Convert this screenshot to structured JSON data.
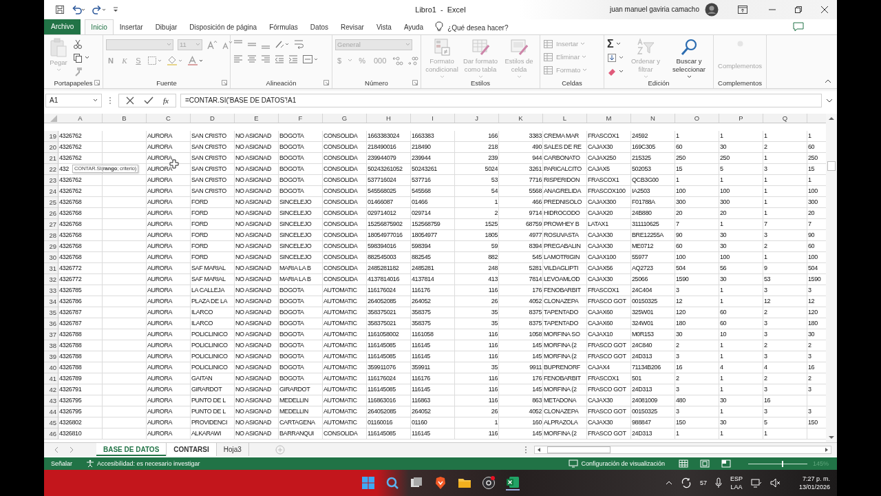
{
  "title_bar": {
    "title": "Libro1  -  Excel",
    "user": "juan manuel gaviria camacho"
  },
  "ribbon_tabs": [
    {
      "label": "Archivo",
      "kind": "file",
      "selected": false
    },
    {
      "label": "Inicio",
      "kind": "tab",
      "selected": true
    },
    {
      "label": "Insertar",
      "kind": "tab",
      "selected": false
    },
    {
      "label": "Dibujar",
      "kind": "tab",
      "selected": false
    },
    {
      "label": "Disposición de página",
      "kind": "tab",
      "selected": false
    },
    {
      "label": "Fórmulas",
      "kind": "tab",
      "selected": false
    },
    {
      "label": "Datos",
      "kind": "tab",
      "selected": false
    },
    {
      "label": "Revisar",
      "kind": "tab",
      "selected": false
    },
    {
      "label": "Vista",
      "kind": "tab",
      "selected": false
    },
    {
      "label": "Ayuda",
      "kind": "tab",
      "selected": false
    }
  ],
  "tell_me": {
    "placeholder": "¿Qué desea hacer?"
  },
  "ribbon": [
    {
      "kind": "clipboard",
      "label": "Portapapeles",
      "items": [
        {
          "label": "Pegar",
          "disabled": true
        }
      ]
    },
    {
      "kind": "font",
      "label": "Fuente",
      "disabled": true,
      "size": "11",
      "styles": [
        "N",
        "K",
        "S"
      ]
    },
    {
      "kind": "alignment",
      "label": "Alineación"
    },
    {
      "kind": "number",
      "label": "Número",
      "disabled": true,
      "format": "General",
      "symbols": [
        "$",
        "%",
        "000"
      ]
    },
    {
      "kind": "styles",
      "label": "Estilos",
      "items": [
        {
          "label": "Formato condicional",
          "disabled": true
        },
        {
          "label": "Dar formato como tabla",
          "disabled": true
        },
        {
          "label": "Estilos de celda",
          "disabled": true
        }
      ]
    },
    {
      "kind": "cells",
      "label": "Celdas",
      "items": [
        {
          "label": "Insertar",
          "disabled": true
        },
        {
          "label": "Eliminar",
          "disabled": true
        },
        {
          "label": "Formato",
          "disabled": true
        }
      ]
    },
    {
      "kind": "editing",
      "label": "Edición",
      "sum": "Σ",
      "items": [
        {
          "label": "Ordenar y filtrar",
          "disabled": true
        },
        {
          "label": "Buscar y seleccionar",
          "disabled": false
        }
      ]
    },
    {
      "kind": "addins",
      "label": "Complementos",
      "items": [
        {
          "label": "Complementos",
          "disabled": true
        }
      ]
    }
  ],
  "formula_bar": {
    "name_box": "A1",
    "fx": "fx",
    "formula": "=CONTAR.SI('BASE DE DATOS'!A1"
  },
  "columns": [
    {
      "label": "A",
      "kind": "text"
    },
    {
      "label": "B",
      "kind": "text"
    },
    {
      "label": "C",
      "kind": "text"
    },
    {
      "label": "D",
      "kind": "text"
    },
    {
      "label": "E",
      "kind": "text"
    },
    {
      "label": "F",
      "kind": "text"
    },
    {
      "label": "G",
      "kind": "text"
    },
    {
      "label": "H",
      "kind": "text"
    },
    {
      "label": "I",
      "kind": "text"
    },
    {
      "label": "J",
      "kind": "number"
    },
    {
      "label": "K",
      "kind": "number"
    },
    {
      "label": "L",
      "kind": "text"
    },
    {
      "label": "M",
      "kind": "text"
    },
    {
      "label": "N",
      "kind": "text"
    },
    {
      "label": "O",
      "kind": "text"
    },
    {
      "label": "P",
      "kind": "text"
    },
    {
      "label": "Q",
      "kind": "text"
    },
    {
      "kind": "text"
    }
  ],
  "rows": [
    {
      "number": "19",
      "cells": [
        "4326762",
        null,
        "AURORA",
        "SAN CRISTO",
        "NO ASIGNAD",
        "BOGOTA",
        "CONSOLIDA",
        "1663383024",
        "1663383",
        "166",
        "3383",
        "CREMA MAR",
        "FRASCOX1",
        "24592",
        "1",
        "1",
        "1",
        "1"
      ]
    },
    {
      "number": "20",
      "cells": [
        "4326762",
        null,
        "AURORA",
        "SAN CRISTO",
        "NO ASIGNAD",
        "BOGOTA",
        "CONSOLIDA",
        "218490016",
        "218490",
        "218",
        "490",
        "SALES DE RE",
        "CAJAX30",
        "169C305",
        "60",
        "30",
        "2",
        "60"
      ]
    },
    {
      "number": "21",
      "cells": [
        "4326762",
        null,
        "AURORA",
        "SAN CRISTO",
        "NO ASIGNAD",
        "BOGOTA",
        "CONSOLIDA",
        "239944079",
        "239944",
        "239",
        "944",
        "CARBONATO",
        "CAJAX250",
        "215325",
        "250",
        "250",
        "1",
        "250"
      ]
    },
    {
      "number": "22",
      "cells": [
        "432",
        null,
        "AURORA",
        "SAN CRISTO",
        "NO ASIGNAD",
        "BOGOTA",
        "CONSOLIDA",
        "50243261052",
        "50243261",
        "5024",
        "3261",
        "PARICALCITO",
        "CAJAX5",
        "502053",
        "15",
        "5",
        "3",
        "15"
      ]
    },
    {
      "number": "23",
      "cells": [
        "4326762",
        null,
        "AURORA",
        "SAN CRISTO",
        "NO ASIGNAD",
        "BOGOTA",
        "CONSOLIDA",
        "537716024",
        "537716",
        "53",
        "7716",
        "RISPERIDON",
        "FRASCOX1",
        "QCB3G00",
        "1",
        "1",
        "1",
        "1"
      ]
    },
    {
      "number": "24",
      "cells": [
        "4326762",
        null,
        "AURORA",
        "SAN CRISTO",
        "NO ASIGNAD",
        "BOGOTA",
        "CONSOLIDA",
        "545568025",
        "545568",
        "54",
        "5568",
        "ANAGRELIDA",
        "FRASCOX100",
        "IA2503",
        "100",
        "100",
        "1",
        "100"
      ]
    },
    {
      "number": "25",
      "cells": [
        "4326768",
        null,
        "AURORA",
        "FORD",
        "NO ASIGNAD",
        "SINCELEJO",
        "CONSOLIDA",
        "01466087",
        "01466",
        "1",
        "466",
        "PREDNISOLO",
        "CAJAX300",
        "F01788A",
        "300",
        "300",
        "1",
        "300"
      ]
    },
    {
      "number": "26",
      "cells": [
        "4326768",
        null,
        "AURORA",
        "FORD",
        "NO ASIGNAD",
        "SINCELEJO",
        "CONSOLIDA",
        "029714012",
        "029714",
        "2",
        "9714",
        "HIDROCODO",
        "CAJAX20",
        "24B880",
        "20",
        "20",
        "1",
        "20"
      ]
    },
    {
      "number": "27",
      "cells": [
        "4326768",
        null,
        "AURORA",
        "FORD",
        "NO ASIGNAD",
        "SINCELEJO",
        "CONSOLIDA",
        "15256875902",
        "152568759",
        "1525",
        "68759",
        "PROWHEY B",
        "LATAX1",
        "311110625",
        "7",
        "1",
        "7",
        "7"
      ]
    },
    {
      "number": "28",
      "cells": [
        "4326768",
        null,
        "AURORA",
        "FORD",
        "NO ASIGNAD",
        "SINCELEJO",
        "CONSOLIDA",
        "18054977016",
        "18054977",
        "1805",
        "4977",
        "ROSUVASTA",
        "CAJAX30",
        "BRE12255A",
        "90",
        "30",
        "3",
        "90"
      ]
    },
    {
      "number": "29",
      "cells": [
        "4326768",
        null,
        "AURORA",
        "FORD",
        "NO ASIGNAD",
        "SINCELEJO",
        "CONSOLIDA",
        "598394016",
        "598394",
        "59",
        "8394",
        "PREGABALIN",
        "CAJAX30",
        "ME0712",
        "60",
        "30",
        "2",
        "60"
      ]
    },
    {
      "number": "30",
      "cells": [
        "4326768",
        null,
        "AURORA",
        "FORD",
        "NO ASIGNAD",
        "SINCELEJO",
        "CONSOLIDA",
        "882545003",
        "882545",
        "882",
        "545",
        "LAMOTRIGIN",
        "CAJAX100",
        "55977",
        "100",
        "100",
        "1",
        "100"
      ]
    },
    {
      "number": "31",
      "cells": [
        "4326772",
        null,
        "AURORA",
        "SAF MARIAL",
        "NO ASIGNAD",
        "MARIA LA B",
        "CONSOLIDA",
        "2485281182",
        "2485281",
        "248",
        "5281",
        "VILDAGLIPTI",
        "CAJAX56",
        "AQ2723",
        "504",
        "56",
        "9",
        "504"
      ]
    },
    {
      "number": "32",
      "cells": [
        "4326772",
        null,
        "AURORA",
        "SAF MARIAL",
        "NO ASIGNAD",
        "MARIA LA B",
        "CONSOLIDA",
        "4137814016",
        "4137814",
        "413",
        "7814",
        "LEVOAMLOD",
        "CAJAX30",
        "25066",
        "1590",
        "30",
        "53",
        "1590"
      ]
    },
    {
      "number": "33",
      "cells": [
        "4326785",
        null,
        "AURORA",
        "LA CALLEJA",
        "NO ASIGNAD",
        "BOGOTA",
        "AUTOMATIC",
        "116176024",
        "116176",
        "116",
        "176",
        "FENOBARBIT",
        "FRASCOX1",
        "24C404",
        "3",
        "1",
        "3",
        "3"
      ]
    },
    {
      "number": "34",
      "cells": [
        "4326786",
        null,
        "AURORA",
        "PLAZA DE LA",
        "NO ASIGNAD",
        "BOGOTA",
        "AUTOMATIC",
        "264052085",
        "264052",
        "26",
        "4052",
        "CLONAZEPA",
        "FRASCO GOT",
        "00150325",
        "12",
        "1",
        "12",
        "12"
      ]
    },
    {
      "number": "35",
      "cells": [
        "4326787",
        null,
        "AURORA",
        "ILARCO",
        "NO ASIGNAD",
        "BOGOTA",
        "AUTOMATIC",
        "358375021",
        "358375",
        "35",
        "8375",
        "TAPENTADO",
        "CAJAX60",
        "325W01",
        "120",
        "60",
        "2",
        "120"
      ]
    },
    {
      "number": "36",
      "cells": [
        "4326787",
        null,
        "AURORA",
        "ILARCO",
        "NO ASIGNAD",
        "BOGOTA",
        "AUTOMATIC",
        "358375021",
        "358375",
        "35",
        "8375",
        "TAPENTADO",
        "CAJAX60",
        "324W01",
        "180",
        "60",
        "3",
        "180"
      ]
    },
    {
      "number": "37",
      "cells": [
        "4326788",
        null,
        "AURORA",
        "POLICLINICO",
        "NO ASIGNAD",
        "BOGOTA",
        "AUTOMATIC",
        "1161058002",
        "1161058",
        "116",
        "1058",
        "MORFINA SO",
        "CAJAX10",
        "M0R153",
        "30",
        "10",
        "3",
        "30"
      ]
    },
    {
      "number": "38",
      "cells": [
        "4326788",
        null,
        "AURORA",
        "POLICLINICO",
        "NO ASIGNAD",
        "BOGOTA",
        "AUTOMATIC",
        "116145085",
        "116145",
        "116",
        "145",
        "MORFINA (2",
        "FRASCO GOT",
        "24C840",
        "2",
        "1",
        "2",
        "2"
      ]
    },
    {
      "number": "39",
      "cells": [
        "4326788",
        null,
        "AURORA",
        "POLICLINICO",
        "NO ASIGNAD",
        "BOGOTA",
        "AUTOMATIC",
        "116145085",
        "116145",
        "116",
        "145",
        "MORFINA (2",
        "FRASCO GOT",
        "24D313",
        "3",
        "1",
        "3",
        "3"
      ]
    },
    {
      "number": "40",
      "cells": [
        "4326788",
        null,
        "AURORA",
        "POLICLINICO",
        "NO ASIGNAD",
        "BOGOTA",
        "AUTOMATIC",
        "359911076",
        "359911",
        "35",
        "9911",
        "BUPRENORF",
        "CAJAX4",
        "71134B206",
        "16",
        "4",
        "4",
        "16"
      ]
    },
    {
      "number": "41",
      "cells": [
        "4326789",
        null,
        "AURORA",
        "GAITAN",
        "NO ASIGNAD",
        "BOGOTA",
        "AUTOMATIC",
        "116176024",
        "116176",
        "116",
        "176",
        "FENOBARBIT",
        "FRASCOX1",
        "501",
        "2",
        "1",
        "2",
        "2"
      ]
    },
    {
      "number": "42",
      "cells": [
        "4326791",
        null,
        "AURORA",
        "GIRARDOT",
        "NO ASIGNAD",
        "GIRARDOT",
        "AUTOMATIC",
        "116145085",
        "116145",
        "116",
        "145",
        "MORFINA (2",
        "FRASCO GOT",
        "24D313",
        "3",
        "1",
        "3",
        "3"
      ]
    },
    {
      "number": "43",
      "cells": [
        "4326795",
        null,
        "AURORA",
        "PUNTO DE L",
        "NO ASIGNAD",
        "MEDELLIN",
        "AUTOMATIC",
        "116863016",
        "116863",
        "116",
        "863",
        "METADONA",
        "CAJAX30",
        "24081009",
        "480",
        "30",
        "16",
        null
      ]
    },
    {
      "number": "44",
      "cells": [
        "4326795",
        null,
        "AURORA",
        "PUNTO DE L",
        "NO ASIGNAD",
        "MEDELLIN",
        "AUTOMATIC",
        "264052085",
        "264052",
        "26",
        "4052",
        "CLONAZEPA",
        "FRASCO GOT",
        "00150325",
        "3",
        "1",
        "3",
        "3"
      ]
    },
    {
      "number": "45",
      "cells": [
        "4326802",
        null,
        "AURORA",
        "PROVIDENCI",
        "NO ASIGNAD",
        "CARTAGENA",
        "AUTOMATIC",
        "01160016",
        "01160",
        "1",
        "160",
        "ALPRAZOLA",
        "CAJAX30",
        "988847",
        "150",
        "30",
        "5",
        "150"
      ]
    },
    {
      "number": "46",
      "cells": [
        "4326810",
        null,
        "AURORA",
        "ALKARAWI",
        "NO ASIGNAD",
        "BARRANQUI",
        "CONSOLIDA",
        "116145085",
        "116145",
        "116",
        "145",
        "MORFINA (2",
        "FRASCO GOT",
        "24D313",
        "1",
        "1",
        "1",
        null
      ]
    }
  ],
  "tooltip": "CONTAR.SI(**rango**; criterio)",
  "sheet_tabs": [
    {
      "label": "BASE DE DATOS",
      "selected": true,
      "active": true
    },
    {
      "label": "CONTARSI",
      "selected": true,
      "active": false
    },
    {
      "label": "Hoja3",
      "selected": false,
      "active": false
    }
  ],
  "status_bar": {
    "mode": "Señalar",
    "accessibility": "Accesibilidad: es necesario investigar",
    "display_settings": "Configuración de visualización",
    "zoom": {
      "level": 0.58,
      "reading": "145%"
    }
  },
  "taskbar": {
    "counter": "57",
    "language": "ESP",
    "layout": "LAA",
    "time": "7:27 p. m.",
    "date": "13/01/2026"
  }
}
